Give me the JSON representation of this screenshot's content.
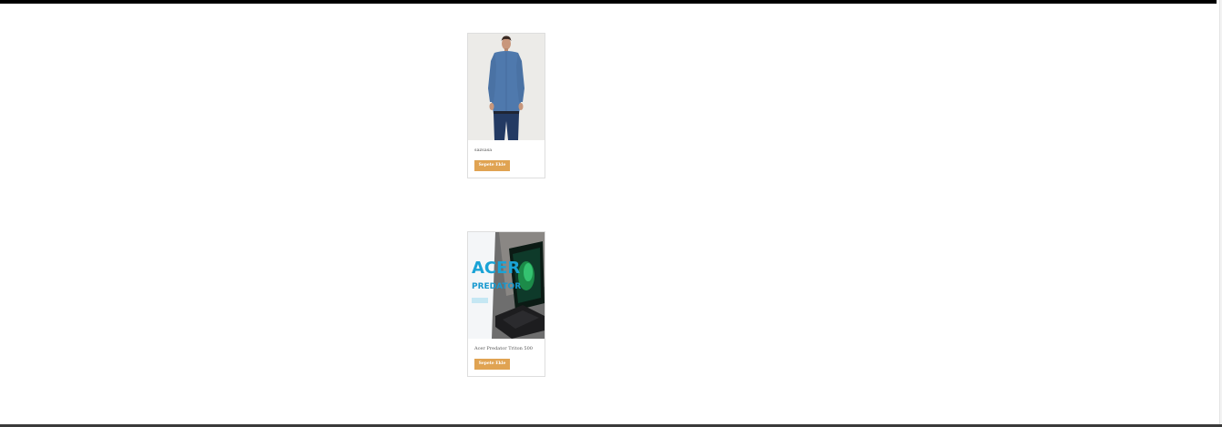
{
  "products": [
    {
      "title": "sazsasa",
      "button_label": "Sepete Ekle",
      "image": "man-blue-shirt-photo"
    },
    {
      "title": "Acer Predator Triton 500",
      "button_label": "Sepete Ekle",
      "image": "acer-predator-laptop-photo",
      "image_text": {
        "brand": "ACER",
        "line": "PREDATOR"
      }
    }
  ],
  "colors": {
    "button": "#e0a352",
    "top_bar": "#000000",
    "card_border": "#dedede"
  }
}
